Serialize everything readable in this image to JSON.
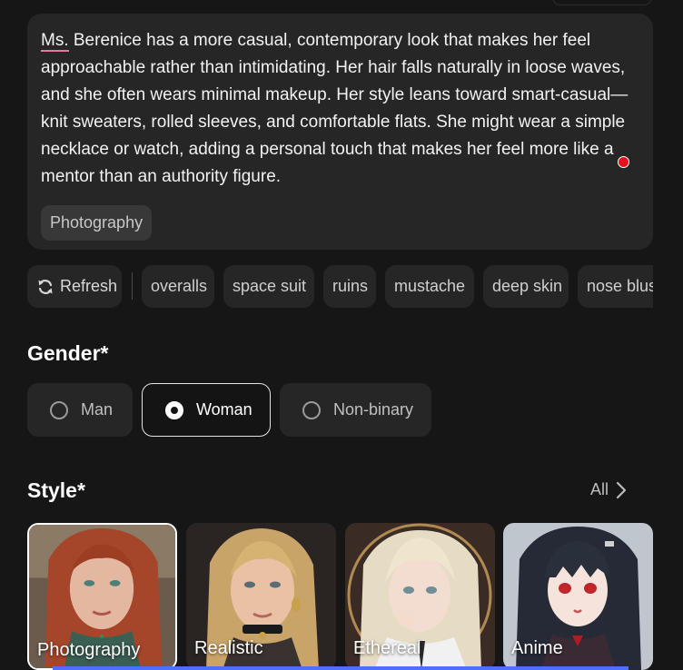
{
  "prompt": {
    "text_prefix": "Ms.",
    "text_rest": " Berenice has a more casual, contemporary look that makes her feel approachable rather than intimidating. Her hair falls naturally in loose waves, and she often wears minimal makeup. Her style leans toward smart-casual—knit sweaters, rolled sleeves, and comfortable flats. She might wear a simple necklace or watch, adding a personal touch that makes her feel more like a mentor than an authority figure.",
    "tag": "Photography"
  },
  "chips": {
    "refresh_label": "Refresh",
    "items": [
      "overalls",
      "space suit",
      "ruins",
      "mustache",
      "deep skin",
      "nose blush"
    ]
  },
  "gender": {
    "title": "Gender*",
    "options": [
      "Man",
      "Woman",
      "Non-binary"
    ],
    "selected": "Woman"
  },
  "style": {
    "title": "Style*",
    "all_label": "All",
    "cards": [
      "Photography",
      "Realistic",
      "Ethereal",
      "Anime"
    ],
    "selected": "Photography"
  },
  "colors": {
    "background": "#161616",
    "panel": "#262626",
    "accent_underline": "#e8789a",
    "recording_dot": "#e8101a"
  }
}
